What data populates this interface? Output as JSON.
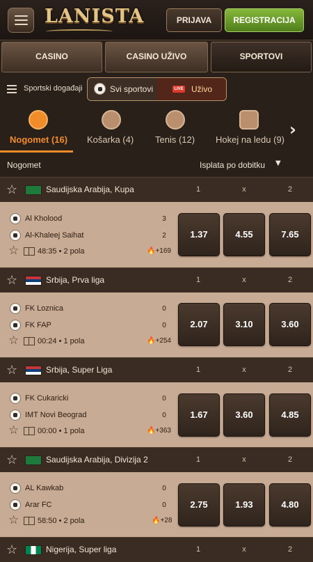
{
  "header": {
    "logo": "LANISTA",
    "login": "PRIJAVA",
    "register": "REGISTRACIJA"
  },
  "nav": [
    "CASINO",
    "CASINO UŽIVO",
    "SPORTOVI"
  ],
  "filter": {
    "label": "Sportski događaji",
    "all_sports": "Svi sportovi",
    "live_badge": "LIVE",
    "live": "Uživo"
  },
  "sports": [
    {
      "label": "Nogomet (16)",
      "icon": "soccer-ball-icon"
    },
    {
      "label": "Košarka (4)",
      "icon": "basketball-icon"
    },
    {
      "label": "Tenis (12)",
      "icon": "tennis-ball-icon"
    },
    {
      "label": "Hokej na ledu (9)",
      "icon": "hockey-icon"
    }
  ],
  "list_header": {
    "title": "Nogomet",
    "sort": "Isplata po dobitku"
  },
  "colors": {
    "accent_orange": "#f08c2a",
    "register_green": "#6fa22e",
    "live_red": "#e03a2c"
  },
  "groups": [
    {
      "league": "Saudijska Arabija, Kupa",
      "flag": "saudi-arabia",
      "cols": [
        "1",
        "x",
        "2"
      ],
      "home": "Al Kholood",
      "away": "Al-Khaleej Saihat",
      "home_score": "3",
      "away_score": "2",
      "time": "48:35 • 2 pola",
      "more": "+169",
      "odds": [
        "1.37",
        "4.55",
        "7.65"
      ]
    },
    {
      "league": "Srbija, Prva liga",
      "flag": "serbia",
      "cols": [
        "1",
        "x",
        "2"
      ],
      "home": "FK Loznica",
      "away": "FK FAP",
      "home_score": "0",
      "away_score": "0",
      "time": "00:24 • 1 pola",
      "more": "+254",
      "odds": [
        "2.07",
        "3.10",
        "3.60"
      ]
    },
    {
      "league": "Srbija, Super Liga",
      "flag": "serbia",
      "cols": [
        "1",
        "x",
        "2"
      ],
      "home": "FK Cukaricki",
      "away": "IMT Novi Beograd",
      "home_score": "0",
      "away_score": "0",
      "time": "00:00 • 1 pola",
      "more": "+363",
      "odds": [
        "1.67",
        "3.60",
        "4.85"
      ]
    },
    {
      "league": "Saudijska Arabija, Divizija 2",
      "flag": "saudi-arabia",
      "cols": [
        "1",
        "x",
        "2"
      ],
      "home": "AL Kawkab",
      "away": "Arar FC",
      "home_score": "0",
      "away_score": "0",
      "time": "58:50 • 2 pola",
      "more": "+28",
      "odds": [
        "2.75",
        "1.93",
        "4.80"
      ]
    },
    {
      "league": "Nigerija, Super liga",
      "flag": "nigeria",
      "cols": [
        "1",
        "x",
        "2"
      ]
    }
  ]
}
